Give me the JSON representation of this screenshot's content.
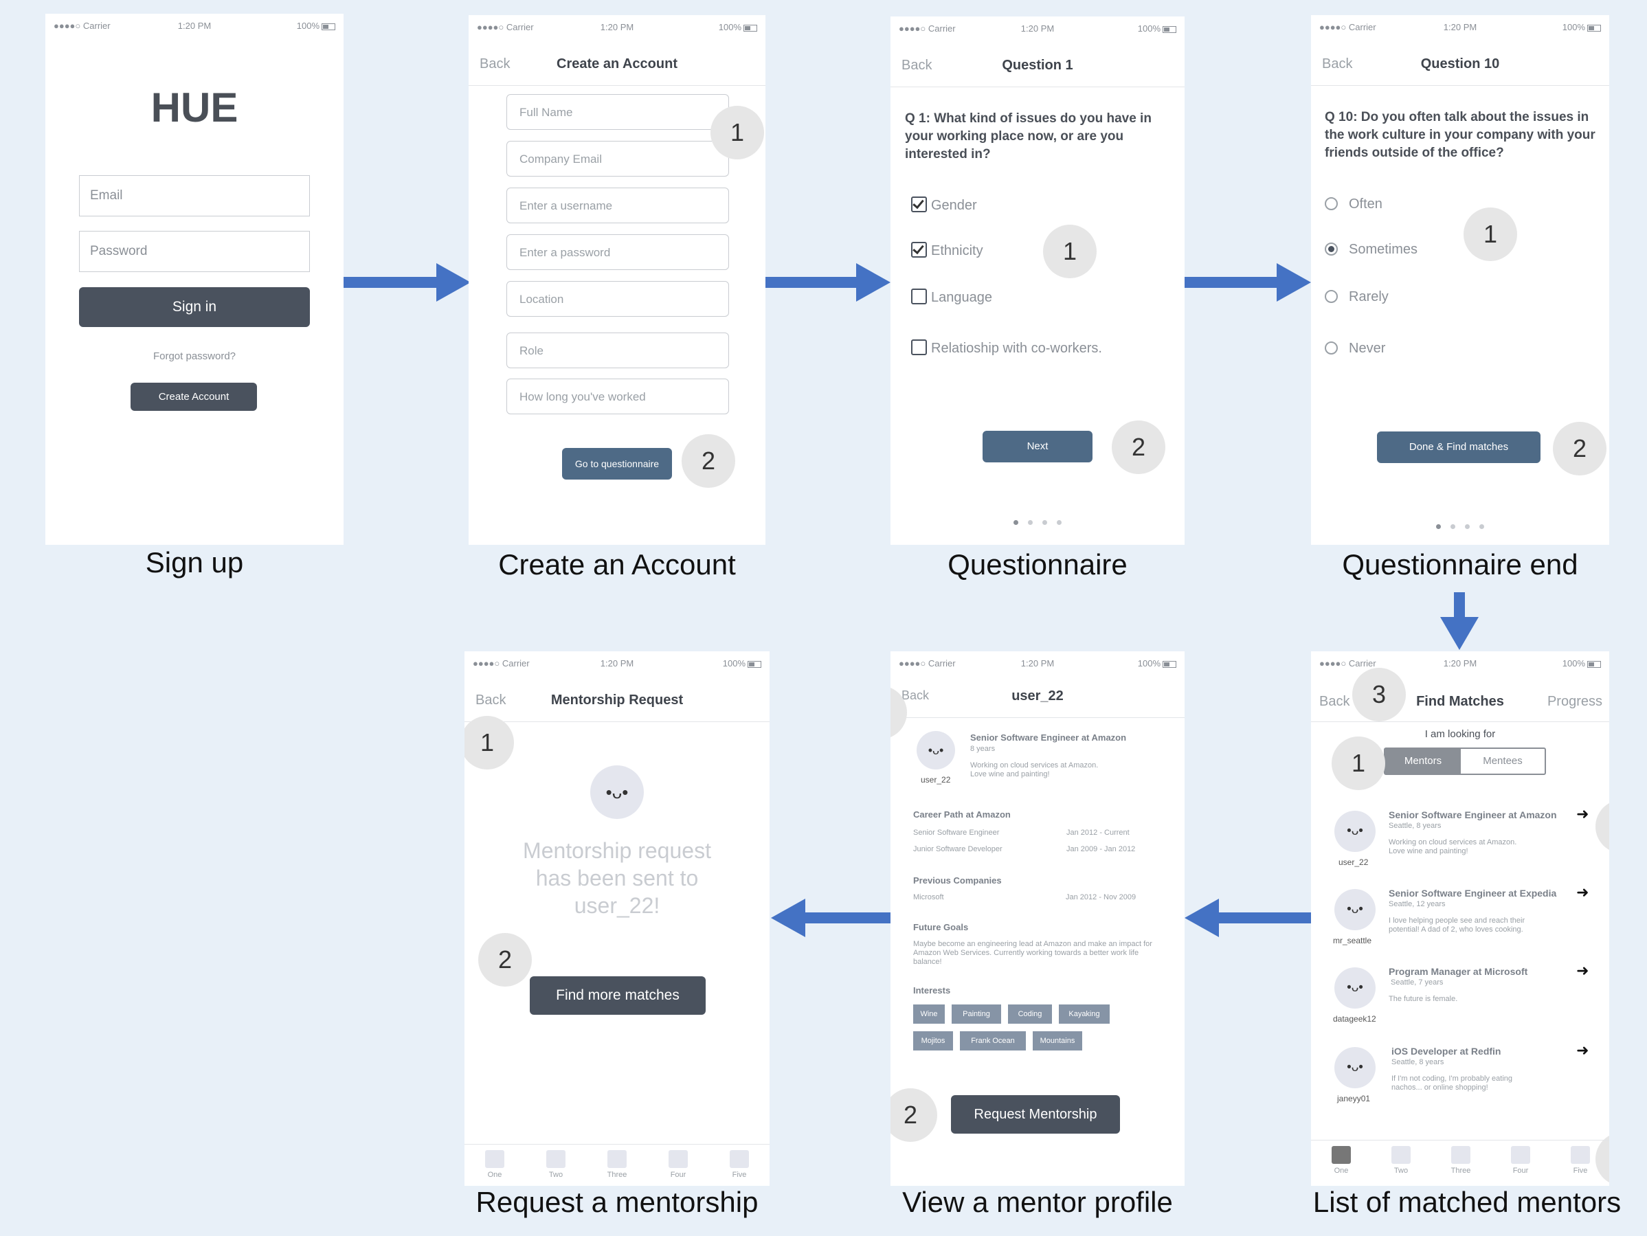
{
  "status": {
    "carrier": "●●●●○ Carrier",
    "time": "1:20 PM",
    "battery": "100%"
  },
  "captions": {
    "sign_up": "Sign up",
    "create_account": "Create an Account",
    "questionnaire": "Questionnaire",
    "questionnaire_end": "Questionnaire end",
    "request_mentorship": "Request a mentorship",
    "view_profile": "View a mentor profile",
    "list_mentors": "List of matched mentors"
  },
  "signin": {
    "logo": "HUE",
    "email_placeholder": "Email",
    "password_placeholder": "Password",
    "signin_label": "Sign in",
    "forgot": "Forgot password?",
    "create_label": "Create Account"
  },
  "create": {
    "back": "Back",
    "title": "Create an Account",
    "fields": [
      "Full Name",
      "Company Email",
      "Enter a username",
      "Enter a password",
      "Location",
      "Role",
      "How long you've worked"
    ],
    "go_label": "Go to questionnaire",
    "badge1": "1",
    "badge2": "2"
  },
  "q1": {
    "back": "Back",
    "title": "Question 1",
    "question": "Q 1: What kind of issues do you have in your working place now, or are you interested in?",
    "options": [
      "Gender",
      "Ethnicity",
      "Language",
      "Relatioship with co-workers."
    ],
    "next_label": "Next",
    "badge1": "1",
    "badge2": "2"
  },
  "q10": {
    "back": "Back",
    "title": "Question 10",
    "question": "Q 10: Do you often talk about the issues in the work culture in your company with your friends outside of the office?",
    "options": [
      "Often",
      "Sometimes",
      "Rarely",
      "Never"
    ],
    "done_label": "Done & Find matches",
    "badge1": "1",
    "badge2": "2"
  },
  "request": {
    "back": "Back",
    "title": "Mentorship Request",
    "face": "•ᴗ•",
    "message": "Mentorship request has been sent to user_22!",
    "find_label": "Find more matches",
    "badge1": "1",
    "badge2": "2",
    "tabs": [
      "One",
      "Two",
      "Three",
      "Four",
      "Five"
    ]
  },
  "profile": {
    "back": "Back",
    "title": "user_22",
    "face": "•ᴗ•",
    "username": "user_22",
    "headline": "Senior Software Engineer at Amazon",
    "years": "8 years",
    "bio": "Working on cloud services at Amazon. Love wine and painting!",
    "career_heading": "Career Path at Amazon",
    "career": [
      {
        "role": "Senior Software Engineer",
        "dates": "Jan 2012 - Current"
      },
      {
        "role": "Junior Software Developer",
        "dates": "Jan 2009 - Jan 2012"
      }
    ],
    "prev_heading": "Previous Companies",
    "prev": [
      {
        "company": "Microsoft",
        "dates": "Jan 2012 - Nov 2009"
      }
    ],
    "goals_heading": "Future Goals",
    "goals": "Maybe become an engineering lead at Amazon and make an impact for Amazon Web Services. Currently working towards a better work life balance!",
    "interests_heading": "Interests",
    "interests": [
      "Wine",
      "Painting",
      "Coding",
      "Kayaking",
      "Mojitos",
      "Frank Ocean",
      "Mountains"
    ],
    "request_label": "Request Mentorship",
    "badge2": "2"
  },
  "matches": {
    "back": "Back",
    "title": "Find Matches",
    "progress": "Progress",
    "looking": "I am looking for",
    "seg": [
      "Mentors",
      "Mentees"
    ],
    "badge1": "1",
    "badge3": "3",
    "face": "•ᴗ•",
    "arrow": "➜",
    "list": [
      {
        "title": "Senior Software Engineer at Amazon",
        "meta": "Seattle, 8 years",
        "bio": "Working on cloud services at Amazon. Love wine and painting!",
        "user": "user_22"
      },
      {
        "title": "Senior Software Engineer at Expedia",
        "meta": "Seattle, 12 years",
        "bio": "I love helping people see and reach their potential! A dad of 2, who loves cooking.",
        "user": "mr_seattle"
      },
      {
        "title": "Program Manager at Microsoft",
        "meta": "Seattle, 7 years",
        "bio": "The future is female.",
        "user": "datageek12"
      },
      {
        "title": "iOS Developer at Redfin",
        "meta": "Seattle, 8 years",
        "bio": "If I'm not coding, I'm probably eating nachos... or online shopping!",
        "user": "janeyy01"
      }
    ],
    "tabs": [
      "One",
      "Two",
      "Three",
      "Four",
      "Five"
    ]
  },
  "colors": {
    "arrow": "#4472c4",
    "dark_button": "#4a525e",
    "blue_button": "#4e6a86",
    "badge": "#e6e6e6"
  }
}
